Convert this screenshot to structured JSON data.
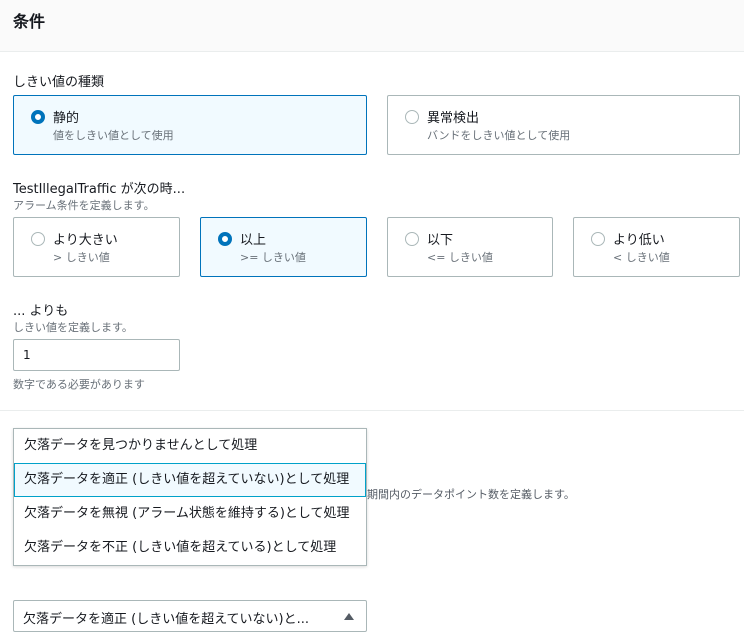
{
  "section": {
    "title": "条件"
  },
  "threshold_type": {
    "label": "しきい値の種類",
    "options": [
      {
        "label": "静的",
        "desc": "値をしきい値として使用",
        "selected": true
      },
      {
        "label": "異常検出",
        "desc": "バンドをしきい値として使用",
        "selected": false
      }
    ]
  },
  "condition": {
    "label": "TestIllegalTraffic が次の時...",
    "desc": "アラーム条件を定義します。",
    "options": [
      {
        "label": "より大きい",
        "desc": "> しきい値",
        "selected": false
      },
      {
        "label": "以上",
        "desc": ">= しきい値",
        "selected": true
      },
      {
        "label": "以下",
        "desc": "<= しきい値",
        "selected": false
      },
      {
        "label": "より低い",
        "desc": "< しきい値",
        "selected": false
      }
    ]
  },
  "threshold": {
    "label": "... よりも",
    "desc": "しきい値を定義します。",
    "value": "1",
    "hint": "数字である必要があります"
  },
  "background_text": "n期間内のデータポイント数を定義します。",
  "missing_data": {
    "options": [
      "欠落データを見つかりませんとして処理",
      "欠落データを適正 (しきい値を超えていない)として処理",
      "欠落データを無視 (アラーム状態を維持する)として処理",
      "欠落データを不正 (しきい値を超えている)として処理"
    ],
    "selected_index": 1,
    "selected_display": "欠落データを適正 (しきい値を超えていない)と..."
  }
}
